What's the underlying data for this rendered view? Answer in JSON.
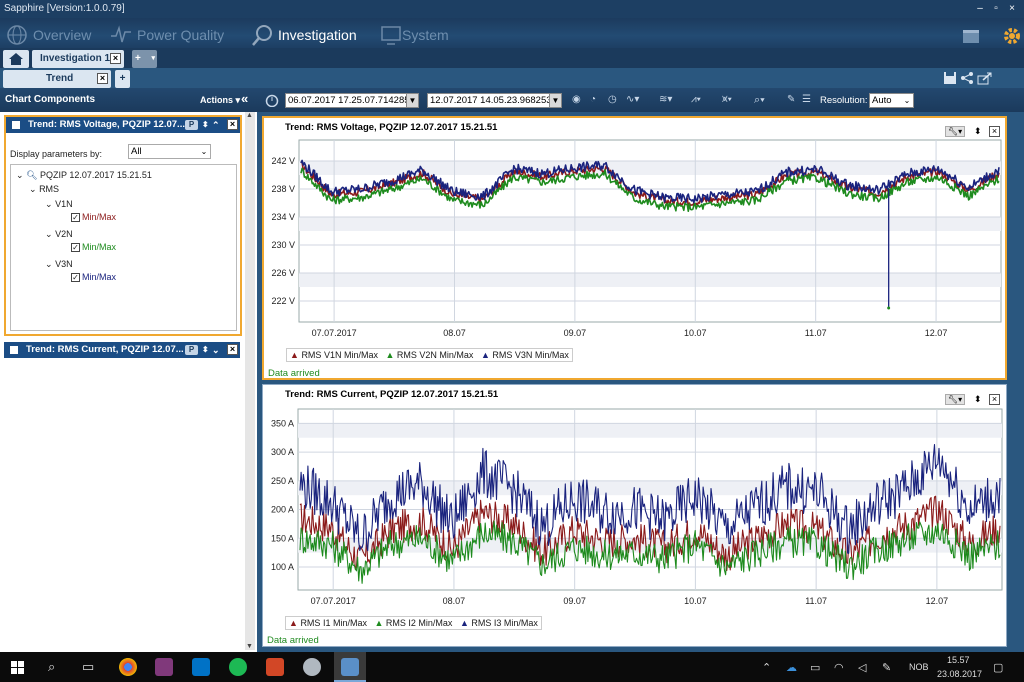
{
  "window": {
    "title": "Sapphire [Version:1.0.0.79]"
  },
  "nav": {
    "items": [
      {
        "label": "Overview"
      },
      {
        "label": "Power Quality"
      },
      {
        "label": "Investigation"
      },
      {
        "label": "System"
      }
    ],
    "active_index": 2
  },
  "tabs": {
    "investigation_tab": "Investigation 1",
    "trend_tab": "Trend",
    "add_symbol": "+",
    "close_symbol": "×"
  },
  "left_panel": {
    "header": "Chart Components",
    "actions": "Actions ▾",
    "collapse_symbol": "«",
    "panel1": {
      "title": "Trend: RMS Voltage, PQZIP 12.07...",
      "display_label": "Display parameters by:",
      "display_value": "All",
      "tree": {
        "root": "PQZIP 12.07.2017 15.21.51",
        "group": "RMS",
        "channels": [
          {
            "name": "V1N",
            "item": "Min/Max",
            "color": "#8b1a1a"
          },
          {
            "name": "V2N",
            "item": "Min/Max",
            "color": "#1e8b1e"
          },
          {
            "name": "V3N",
            "item": "Min/Max",
            "color": "#1a237e"
          }
        ]
      }
    },
    "panel2": {
      "title": "Trend: RMS Current, PQZIP 12.07..."
    },
    "p_badge": "P"
  },
  "toolbar": {
    "start_time": "06.07.2017 17.25.07.714285",
    "end_time": "12.07.2017 14.05.23.968253",
    "resolution_label": "Resolution:",
    "resolution_value": "Auto"
  },
  "charts": [
    {
      "title": "Trend: RMS Voltage, PQZIP 12.07.2017 15.21.51",
      "status": "Data arrived",
      "legend": [
        {
          "label": "RMS V1N Min/Max",
          "color": "#8b1a1a"
        },
        {
          "label": "RMS V2N Min/Max",
          "color": "#1e8b1e"
        },
        {
          "label": "RMS V3N Min/Max",
          "color": "#1a237e"
        }
      ],
      "y_ticks": [
        "242 V",
        "238 V",
        "234 V",
        "230 V",
        "226 V",
        "222 V"
      ],
      "x_ticks": [
        "07.07.2017",
        "08.07",
        "09.07",
        "10.07",
        "11.07",
        "12.07"
      ]
    },
    {
      "title": "Trend: RMS Current, PQZIP 12.07.2017 15.21.51",
      "status": "Data arrived",
      "legend": [
        {
          "label": "RMS I1 Min/Max",
          "color": "#8b1a1a"
        },
        {
          "label": "RMS I2 Min/Max",
          "color": "#1e8b1e"
        },
        {
          "label": "RMS I3 Min/Max",
          "color": "#1a237e"
        }
      ],
      "y_ticks": [
        "350 A",
        "300 A",
        "250 A",
        "200 A",
        "150 A",
        "100 A"
      ],
      "x_ticks": [
        "07.07.2017",
        "08.07",
        "09.07",
        "10.07",
        "11.07",
        "12.07"
      ]
    }
  ],
  "chart_data": [
    {
      "type": "line",
      "title": "Trend: RMS Voltage, PQZIP 12.07.2017 15.21.51",
      "x": [
        "06.07 18:00",
        "07.07 00:00",
        "07.07 06:00",
        "07.07 12:00",
        "07.07 18:00",
        "08.07 00:00",
        "08.07 06:00",
        "08.07 12:00",
        "08.07 18:00",
        "09.07 00:00",
        "09.07 06:00",
        "09.07 12:00",
        "09.07 18:00",
        "10.07 00:00",
        "10.07 06:00",
        "10.07 12:00",
        "10.07 18:00",
        "11.07 00:00",
        "11.07 06:00",
        "11.07 12:00",
        "11.07 18:00",
        "12.07 00:00",
        "12.07 06:00",
        "12.07 12:00"
      ],
      "series": [
        {
          "name": "RMS V1N Min/Max",
          "values": [
            241.5,
            237.2,
            237.6,
            238.8,
            240.3,
            237.2,
            236.5,
            240.5,
            239.8,
            240.6,
            241.0,
            237.4,
            236.3,
            236.2,
            236.8,
            237.2,
            240.0,
            240.4,
            238.2,
            237.4,
            239.8,
            240.5,
            237.8,
            240.3
          ]
        },
        {
          "name": "RMS V2N Min/Max",
          "values": [
            240.7,
            236.4,
            236.8,
            238.0,
            239.5,
            236.4,
            235.7,
            239.7,
            239.0,
            239.8,
            240.2,
            236.6,
            235.5,
            235.4,
            236.0,
            236.4,
            239.2,
            239.6,
            237.4,
            236.6,
            239.0,
            239.7,
            237.0,
            239.5
          ]
        },
        {
          "name": "RMS V3N Min/Max",
          "values": [
            241.9,
            237.6,
            238.0,
            239.2,
            240.7,
            237.6,
            236.9,
            240.9,
            240.2,
            241.0,
            241.4,
            237.8,
            236.7,
            236.6,
            237.2,
            237.6,
            240.4,
            240.8,
            238.6,
            237.8,
            240.2,
            240.9,
            238.2,
            240.7
          ]
        }
      ],
      "ylim": [
        219,
        245
      ]
    },
    {
      "type": "line",
      "title": "Trend: RMS Current, PQZIP 12.07.2017 15.21.51",
      "x": [
        "06.07 18:00",
        "07.07 00:00",
        "07.07 06:00",
        "07.07 12:00",
        "07.07 18:00",
        "08.07 00:00",
        "08.07 06:00",
        "08.07 12:00",
        "08.07 18:00",
        "09.07 00:00",
        "09.07 06:00",
        "09.07 12:00",
        "09.07 18:00",
        "10.07 00:00",
        "10.07 06:00",
        "10.07 12:00",
        "10.07 18:00",
        "11.07 00:00",
        "11.07 06:00",
        "11.07 12:00",
        "11.07 18:00",
        "12.07 00:00",
        "12.07 06:00",
        "12.07 12:00"
      ],
      "series": [
        {
          "name": "RMS I1 Min/Max",
          "values": [
            185,
            170,
            110,
            165,
            180,
            130,
            195,
            175,
            125,
            165,
            145,
            150,
            135,
            165,
            120,
            150,
            175,
            165,
            120,
            155,
            175,
            200,
            140,
            170
          ]
        },
        {
          "name": "RMS I2 Min/Max",
          "values": [
            150,
            140,
            95,
            140,
            150,
            110,
            160,
            145,
            105,
            135,
            120,
            125,
            115,
            140,
            100,
            125,
            145,
            140,
            100,
            130,
            150,
            165,
            120,
            140
          ]
        },
        {
          "name": "RMS I3 Min/Max",
          "values": [
            245,
            215,
            150,
            225,
            245,
            175,
            265,
            235,
            170,
            220,
            195,
            200,
            180,
            225,
            165,
            205,
            240,
            230,
            165,
            210,
            240,
            290,
            200,
            230
          ]
        }
      ],
      "ylim": [
        60,
        375
      ]
    }
  ]
}
